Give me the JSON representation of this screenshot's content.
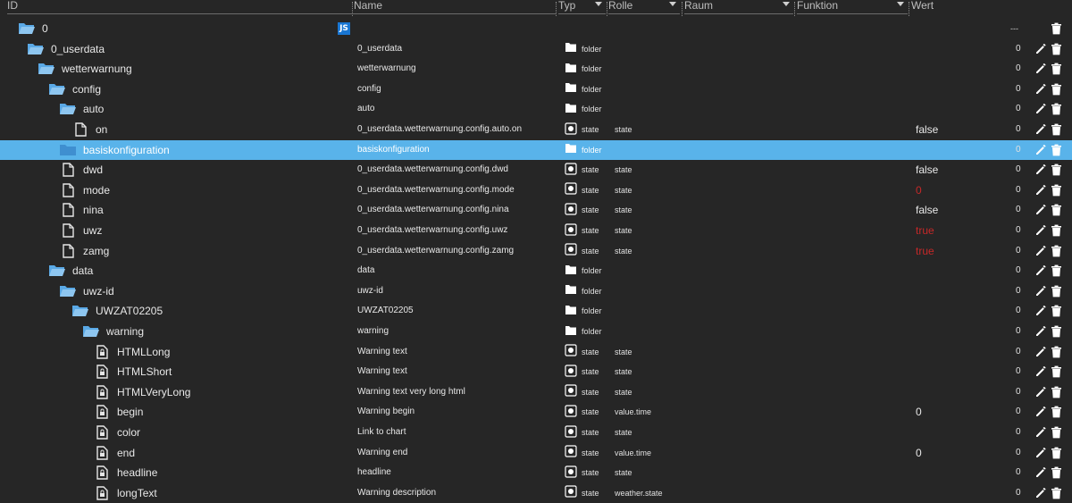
{
  "header": {
    "id": "ID",
    "name": "Name",
    "typ": "Typ",
    "rolle": "Rolle",
    "raum": "Raum",
    "funktion": "Funktion",
    "wert": "Wert",
    "count_header": "---"
  },
  "colors": {
    "background": "#262626",
    "selected": "#59b3ea",
    "red_value": "#c62828",
    "js_badge": "#1976d2"
  },
  "js_badge": "JS",
  "rows": [
    {
      "indent": 0,
      "icon": "folder-open-icon",
      "id": "0",
      "name": "",
      "typ": "",
      "rolle": "",
      "wert": "",
      "count": ""
    },
    {
      "indent": 1,
      "icon": "folder-open-icon",
      "id": "0_userdata",
      "name": "0_userdata",
      "typ": "folder",
      "rolle": "",
      "wert": "",
      "count": "0"
    },
    {
      "indent": 2,
      "icon": "folder-open-icon",
      "id": "wetterwarnung",
      "name": "wetterwarnung",
      "typ": "folder",
      "rolle": "",
      "wert": "",
      "count": "0"
    },
    {
      "indent": 3,
      "icon": "folder-open-icon",
      "id": "config",
      "name": "config",
      "typ": "folder",
      "rolle": "",
      "wert": "",
      "count": "0"
    },
    {
      "indent": 4,
      "icon": "folder-open-icon",
      "id": "auto",
      "name": "auto",
      "typ": "folder",
      "rolle": "",
      "wert": "",
      "count": "0"
    },
    {
      "indent": 5,
      "icon": "file-icon",
      "id": "on",
      "name": "0_userdata.wetterwarnung.config.auto.on",
      "typ": "state",
      "rolle": "state",
      "wert": "false",
      "count": "0"
    },
    {
      "indent": 4,
      "icon": "folder-icon",
      "id": "basiskonfiguration",
      "name": "basiskonfiguration",
      "typ": "folder",
      "rolle": "",
      "wert": "",
      "count": "0",
      "selected": true
    },
    {
      "indent": 4,
      "icon": "file-icon",
      "id": "dwd",
      "name": "0_userdata.wetterwarnung.config.dwd",
      "typ": "state",
      "rolle": "state",
      "wert": "false",
      "count": "0"
    },
    {
      "indent": 4,
      "icon": "file-icon",
      "id": "mode",
      "name": "0_userdata.wetterwarnung.config.mode",
      "typ": "state",
      "rolle": "state",
      "wert": "0",
      "wert_red": true,
      "count": "0"
    },
    {
      "indent": 4,
      "icon": "file-icon",
      "id": "nina",
      "name": "0_userdata.wetterwarnung.config.nina",
      "typ": "state",
      "rolle": "state",
      "wert": "false",
      "count": "0"
    },
    {
      "indent": 4,
      "icon": "file-icon",
      "id": "uwz",
      "name": "0_userdata.wetterwarnung.config.uwz",
      "typ": "state",
      "rolle": "state",
      "wert": "true",
      "wert_red": true,
      "count": "0"
    },
    {
      "indent": 4,
      "icon": "file-icon",
      "id": "zamg",
      "name": "0_userdata.wetterwarnung.config.zamg",
      "typ": "state",
      "rolle": "state",
      "wert": "true",
      "wert_red": true,
      "count": "0"
    },
    {
      "indent": 3,
      "icon": "folder-open-icon",
      "id": "data",
      "name": "data",
      "typ": "folder",
      "rolle": "",
      "wert": "",
      "count": "0"
    },
    {
      "indent": 4,
      "icon": "folder-open-icon",
      "id": "uwz-id",
      "name": "uwz-id",
      "typ": "folder",
      "rolle": "",
      "wert": "",
      "count": "0"
    },
    {
      "indent": 5,
      "icon": "folder-open-icon",
      "id": "UWZAT02205",
      "name": "UWZAT02205",
      "typ": "folder",
      "rolle": "",
      "wert": "",
      "count": "0"
    },
    {
      "indent": 6,
      "icon": "folder-open-icon",
      "id": "warning",
      "name": "warning",
      "typ": "folder",
      "rolle": "",
      "wert": "",
      "count": "0"
    },
    {
      "indent": 7,
      "icon": "file-lock-icon",
      "id": "HTMLLong",
      "name": "Warning text",
      "typ": "state",
      "rolle": "state",
      "wert": "",
      "count": "0"
    },
    {
      "indent": 7,
      "icon": "file-lock-icon",
      "id": "HTMLShort",
      "name": "Warning text",
      "typ": "state",
      "rolle": "state",
      "wert": "",
      "count": "0"
    },
    {
      "indent": 7,
      "icon": "file-lock-icon",
      "id": "HTMLVeryLong",
      "name": "Warning text very long html",
      "typ": "state",
      "rolle": "state",
      "wert": "",
      "count": "0"
    },
    {
      "indent": 7,
      "icon": "file-lock-icon",
      "id": "begin",
      "name": "Warning begin",
      "typ": "state",
      "rolle": "value.time",
      "wert": "0",
      "count": "0"
    },
    {
      "indent": 7,
      "icon": "file-lock-icon",
      "id": "color",
      "name": "Link to chart",
      "typ": "state",
      "rolle": "state",
      "wert": "",
      "count": "0"
    },
    {
      "indent": 7,
      "icon": "file-lock-icon",
      "id": "end",
      "name": "Warning end",
      "typ": "state",
      "rolle": "value.time",
      "wert": "0",
      "count": "0"
    },
    {
      "indent": 7,
      "icon": "file-lock-icon",
      "id": "headline",
      "name": "headline",
      "typ": "state",
      "rolle": "state",
      "wert": "",
      "count": "0"
    },
    {
      "indent": 7,
      "icon": "file-lock-icon",
      "id": "longText",
      "name": "Warning description",
      "typ": "state",
      "rolle": "weather.state",
      "wert": "",
      "count": "0"
    }
  ]
}
